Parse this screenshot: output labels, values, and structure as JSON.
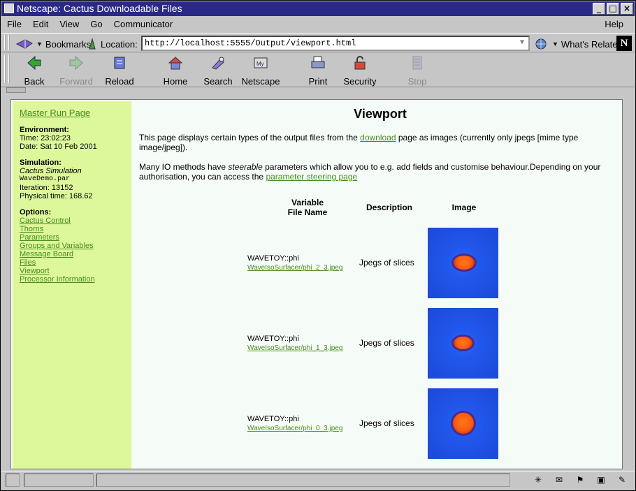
{
  "window": {
    "title": "Netscape: Cactus Downloadable Files",
    "buttons": [
      "_",
      "□",
      "×"
    ]
  },
  "menu": {
    "file": "File",
    "edit": "Edit",
    "view": "View",
    "go": "Go",
    "communicator": "Communicator",
    "help": "Help"
  },
  "location": {
    "bookmarks": "Bookmarks",
    "label": "Location:",
    "url": "http://localhost:5555/Output/viewport.html",
    "whats_related": "What's Related",
    "logo": "N"
  },
  "toolbar": {
    "back": "Back",
    "forward": "Forward",
    "reload": "Reload",
    "home": "Home",
    "search": "Search",
    "netscape": "Netscape",
    "print": "Print",
    "security": "Security",
    "stop": "Stop"
  },
  "sidebar": {
    "master_link": "Master Run Page",
    "environment_heading": "Environment:",
    "time": "Time: 23:02:23",
    "date": "Date: Sat 10 Feb 2001",
    "simulation_heading": "Simulation:",
    "sim_name": "Cactus Simulation",
    "par_file": "WaveDemo.par",
    "iteration": "Iteration: 13152",
    "physical_time": "Physical time: 168.62",
    "options_heading": "Options:",
    "options": [
      "Cactus Control",
      "Thorns",
      "Parameters",
      "Groups and Variables",
      "Message Board",
      "Files",
      "Viewport",
      "Processor Information"
    ]
  },
  "page": {
    "title": "Viewport",
    "p1_a": "This page displays certain types of the output files from the ",
    "p1_link": "download",
    "p1_b": " page as images (currently only jpegs [mime type image/jpeg]).",
    "p2_a": "Many IO methods have ",
    "p2_em": "steerable",
    "p2_b": " parameters which allow you to e.g. add fields and customise behaviour.Depending on your authorisation, you can access the ",
    "p2_link": "parameter steering page",
    "col_var_1": "Variable",
    "col_var_2": "File Name",
    "col_desc": "Description",
    "col_image": "Image"
  },
  "rows": [
    {
      "var": "WAVETOY::phi",
      "file": "WaveIsoSurfacer/phi_2_3.jpeg",
      "desc": "Jpegs of slices"
    },
    {
      "var": "WAVETOY::phi",
      "file": "WaveIsoSurfacer/phi_1_3.jpeg",
      "desc": "Jpegs of slices"
    },
    {
      "var": "WAVETOY::phi",
      "file": "WaveIsoSurfacer/phi_0_3.jpeg",
      "desc": "Jpegs of slices"
    }
  ],
  "colors": {
    "sidebar_bg": "#dcf89a",
    "link": "#4a8a1e",
    "titlebar": "#2a2a86"
  }
}
